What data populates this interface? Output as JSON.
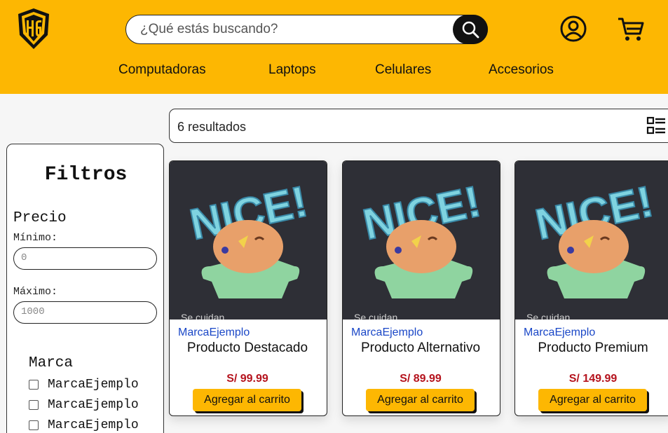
{
  "header": {
    "search_placeholder": "¿Qué estás buscando?",
    "nav": [
      "Computadoras",
      "Laptops",
      "Celulares",
      "Accesorios"
    ]
  },
  "results": {
    "count_text": "6 resultados"
  },
  "filters": {
    "title": "Filtros",
    "price_label": "Precio",
    "min_label": "Mínimo:",
    "min_placeholder": "0",
    "max_label": "Máximo:",
    "max_placeholder": "1000",
    "brand_label": "Marca",
    "brands": [
      "MarcaEjemplo",
      "MarcaEjemplo",
      "MarcaEjemplo"
    ]
  },
  "image": {
    "headline": "NICE!",
    "caption": "Se cuidan"
  },
  "products": [
    {
      "brand": "MarcaEjemplo",
      "name": "Producto Destacado",
      "price": "S/ 99.99",
      "button": "Agregar al carrito"
    },
    {
      "brand": "MarcaEjemplo",
      "name": "Producto Alternativo",
      "price": "S/ 89.99",
      "button": "Agregar al carrito"
    },
    {
      "brand": "MarcaEjemplo",
      "name": "Producto Premium",
      "price": "S/ 149.99",
      "button": "Agregar al carrito"
    }
  ],
  "colors": {
    "accent": "#fdb702",
    "brand_link": "#1a47c7",
    "price": "#b5131d"
  }
}
